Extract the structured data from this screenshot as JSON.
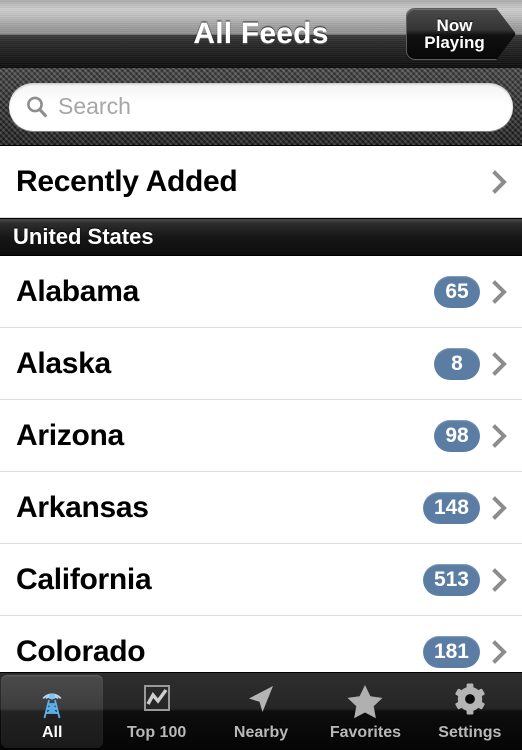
{
  "navbar": {
    "title": "All Feeds",
    "now_playing": {
      "line1": "Now",
      "line2": "Playing"
    }
  },
  "search": {
    "placeholder": "Search",
    "value": "",
    "icon": "search-icon"
  },
  "list": {
    "top_rows": [
      {
        "label": "Recently Added",
        "badge": null,
        "accessory": "chevron-right-icon"
      }
    ],
    "section": {
      "header": "United States",
      "rows": [
        {
          "label": "Alabama",
          "badge": "65",
          "accessory": "chevron-right-icon"
        },
        {
          "label": "Alaska",
          "badge": "8",
          "accessory": "chevron-right-icon"
        },
        {
          "label": "Arizona",
          "badge": "98",
          "accessory": "chevron-right-icon"
        },
        {
          "label": "Arkansas",
          "badge": "148",
          "accessory": "chevron-right-icon"
        },
        {
          "label": "California",
          "badge": "513",
          "accessory": "chevron-right-icon"
        },
        {
          "label": "Colorado",
          "badge": "181",
          "accessory": "chevron-right-icon"
        }
      ]
    }
  },
  "tabbar": {
    "selected_index": 0,
    "items": [
      {
        "label": "All",
        "icon": "radio-tower-icon"
      },
      {
        "label": "Top 100",
        "icon": "chart-icon"
      },
      {
        "label": "Nearby",
        "icon": "navigation-arrow-icon"
      },
      {
        "label": "Favorites",
        "icon": "star-icon"
      },
      {
        "label": "Settings",
        "icon": "gear-icon"
      }
    ]
  },
  "colors": {
    "badge": "#5b7ca3",
    "accent_tower": "#6fc0ef",
    "chevron": "#8c8c8c",
    "row_separator": "#dcdcdc"
  }
}
